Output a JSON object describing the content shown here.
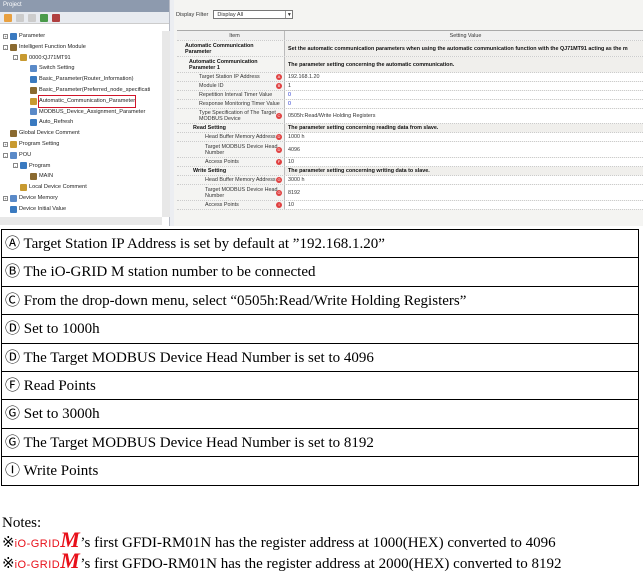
{
  "project": {
    "title": "Project",
    "tree": [
      {
        "label": "Parameter",
        "level": 0,
        "pm": "+"
      },
      {
        "label": "Intelligent Function Module",
        "level": 0,
        "pm": "-"
      },
      {
        "label": "0000:QJ71MT91",
        "level": 1,
        "pm": "-"
      },
      {
        "label": "Switch Setting",
        "level": 2
      },
      {
        "label": "Basic_Parameter(Router_Information)",
        "level": 2
      },
      {
        "label": "Basic_Parameter(Preferred_node_specificati",
        "level": 2
      },
      {
        "label": "Automatic_Communication_Parameter",
        "level": 2,
        "selected": true
      },
      {
        "label": "MODBUS_Device_Assignment_Parameter",
        "level": 2
      },
      {
        "label": "Auto_Refresh",
        "level": 2
      },
      {
        "label": "Global Device Comment",
        "level": 0
      },
      {
        "label": "Program Setting",
        "level": 0,
        "pm": "+"
      },
      {
        "label": "POU",
        "level": 0,
        "pm": "-"
      },
      {
        "label": "Program",
        "level": 1,
        "pm": "-"
      },
      {
        "label": "MAIN",
        "level": 2
      },
      {
        "label": "Local Device Comment",
        "level": 1
      },
      {
        "label": "Device Memory",
        "level": 0,
        "pm": "+"
      },
      {
        "label": "Device Initial Value",
        "level": 0
      }
    ]
  },
  "filter": {
    "label": "Display Filter",
    "value": "Display All"
  },
  "grid": {
    "headers": [
      "Item",
      "Setting Value"
    ],
    "rows": [
      {
        "item": "Automatic Communication Parameter",
        "value": "Set the automatic communication parameters when using the automatic communication function with the QJ71MT91 acting as the m",
        "type": "sec",
        "h": 16,
        "ind": 0
      },
      {
        "item": "Automatic Communication Parameter 1",
        "value": "The parameter setting concerning the automatic communication.",
        "type": "sec",
        "h": 16,
        "ind": 4
      },
      {
        "item": "Target Station IP Address",
        "value": "192.168.1.20",
        "h": 9,
        "ind": 14,
        "mark": "A"
      },
      {
        "item": "Module ID",
        "value": "1",
        "h": 9,
        "ind": 14,
        "mark": "B"
      },
      {
        "item": "Repetition Interval Timer Value",
        "value": "0",
        "h": 9,
        "ind": 14,
        "blue": true
      },
      {
        "item": "Response Monitoring Timer Value",
        "value": "0",
        "h": 9,
        "ind": 14,
        "blue": true
      },
      {
        "item": "Type Specification of The Target MODBUS Device",
        "value": "0505h:Read/Write Holding Registers",
        "h": 15,
        "ind": 14,
        "mark": "C"
      },
      {
        "item": "Read Setting",
        "value": "The parameter setting concerning reading data from slave.",
        "type": "sec",
        "h": 9,
        "ind": 8
      },
      {
        "item": "Head Buffer Memory Address",
        "value": "1000 h",
        "h": 9,
        "ind": 20,
        "mark": "D"
      },
      {
        "item": "Target MODBUS Device Head Number",
        "value": "4096",
        "h": 16,
        "ind": 20,
        "mark": "D"
      },
      {
        "item": "Access Points",
        "value": "10",
        "h": 9,
        "ind": 20,
        "mark": "F"
      },
      {
        "item": "Write Setting",
        "value": "The parameter setting concerning writing data to slave.",
        "type": "sec",
        "h": 9,
        "ind": 8
      },
      {
        "item": "Head Buffer Memory Address",
        "value": "3000 h",
        "h": 9,
        "ind": 20,
        "mark": "G"
      },
      {
        "item": "Target MODBUS Device Head Number",
        "value": "8192",
        "h": 16,
        "ind": 20,
        "mark": "G"
      },
      {
        "item": "Access Points",
        "value": "10",
        "h": 9,
        "ind": 20,
        "mark": "I"
      }
    ]
  },
  "explanations": [
    "Ⓐ Target Station IP Address is set by default at ”192.168.1.20”",
    "Ⓑ The iO-GRID M station number to be connected",
    "Ⓒ From the drop-down menu, select “0505h:Read/Write Holding Registers”",
    "Ⓓ Set to 1000h",
    "Ⓓ The Target MODBUS Device Head Number is set to 4096",
    "Ⓕ Read Points",
    "Ⓖ Set to 3000h",
    "Ⓖ The Target MODBUS Device Head Number is set to 8192",
    "Ⓘ Write Points"
  ],
  "notes": {
    "title": "Notes:",
    "logo_text": "iO-GRID",
    "logo_m": "M",
    "items": [
      "’s first GFDI-RM01N has the register address at 1000(HEX) converted to 4096",
      "’s first GFDO-RM01N has the register address at 2000(HEX) converted to 8192"
    ],
    "mark": "※"
  }
}
